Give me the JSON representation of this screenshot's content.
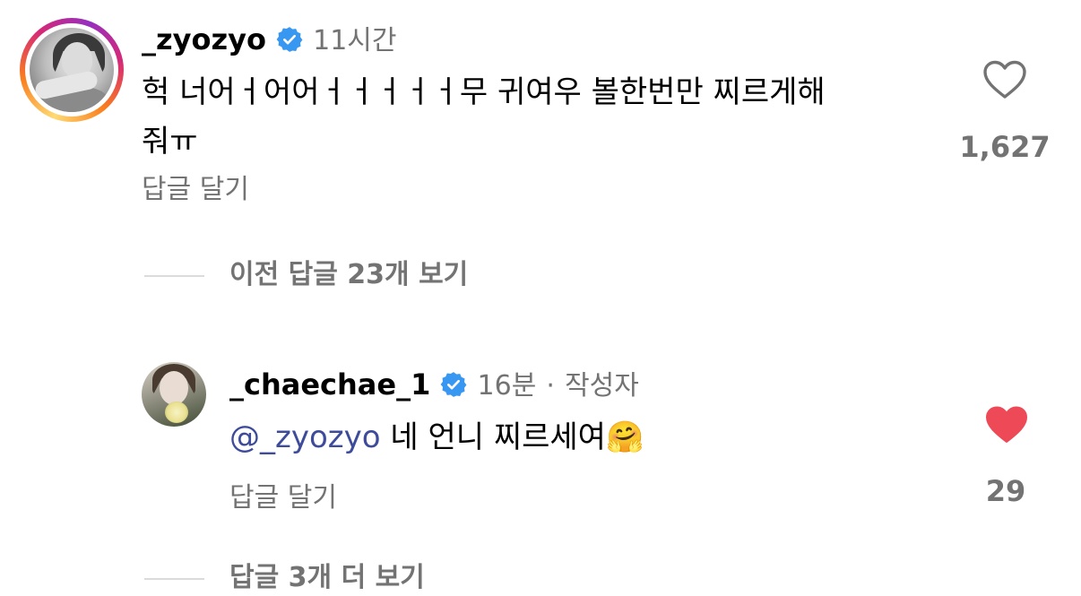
{
  "comments": [
    {
      "username": "_zyozyo",
      "time": "11시간",
      "text_line1": "헉 너어ㅓ어어ㅓㅓㅓㅓㅓ무 귀여우 볼한번만 찌르게해",
      "text_line2": "줘ㅠ",
      "reply_label": "답글 달기",
      "likes": "1,627",
      "liked": false
    },
    {
      "username": "_chaechae_1",
      "time": "16분",
      "separator": "·",
      "author_badge": "작성자",
      "mention": "@_zyozyo",
      "text": "네 언니 찌르세여",
      "emoji": "🤗",
      "reply_label": "답글 달기",
      "likes": "29",
      "liked": true
    }
  ],
  "view_previous_replies": "이전 답글 23개 보기",
  "view_more_replies": "답글 3개 더 보기",
  "colors": {
    "verified": "#3897f0",
    "heart_liked": "#ed4956",
    "secondary_text": "#737373",
    "mention": "#3d4b9a"
  },
  "icons": [
    "verified-badge-icon",
    "heart-outline-icon",
    "heart-filled-icon"
  ]
}
